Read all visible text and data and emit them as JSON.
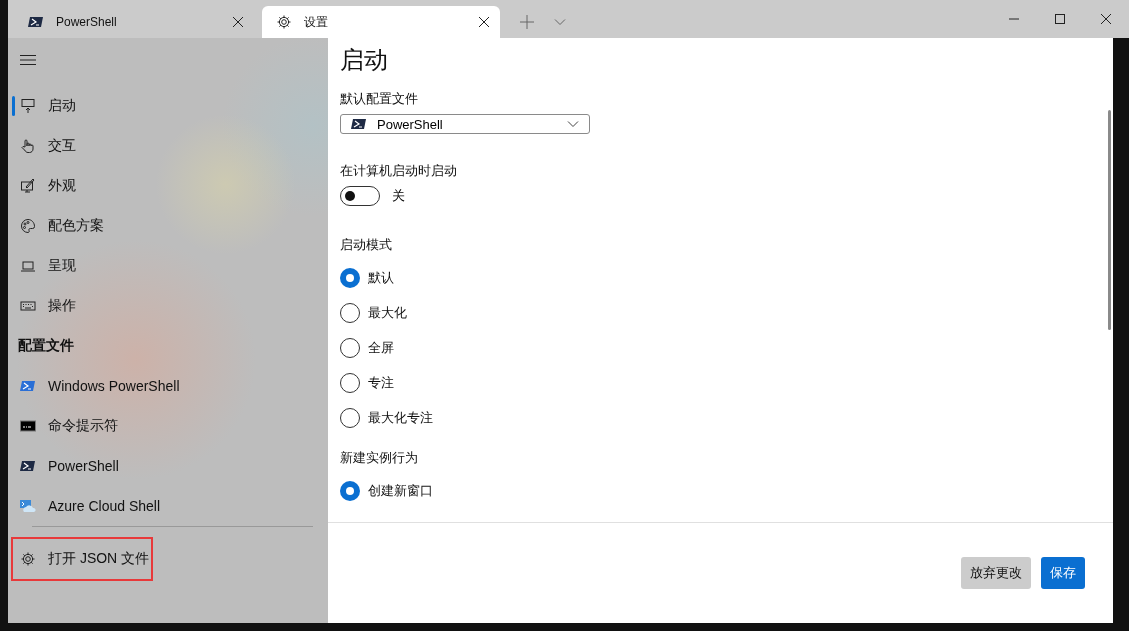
{
  "tabs": [
    {
      "label": "PowerShell",
      "selected": false
    },
    {
      "label": "设置",
      "selected": true
    }
  ],
  "sidebar": {
    "items": [
      {
        "label": "启动",
        "selected": true
      },
      {
        "label": "交互",
        "selected": false
      },
      {
        "label": "外观",
        "selected": false
      },
      {
        "label": "配色方案",
        "selected": false
      },
      {
        "label": "呈现",
        "selected": false
      },
      {
        "label": "操作",
        "selected": false
      }
    ],
    "profiles_heading": "配置文件",
    "profiles": [
      {
        "label": "Windows PowerShell",
        "selected": false
      },
      {
        "label": "命令提示符",
        "selected": false
      },
      {
        "label": "PowerShell",
        "selected": false
      },
      {
        "label": "Azure Cloud Shell",
        "selected": false
      }
    ],
    "open_json": {
      "label": "打开 JSON 文件",
      "highlighted": true
    }
  },
  "page": {
    "title": "启动",
    "default_profile": {
      "label": "默认配置文件",
      "value": "PowerShell"
    },
    "launch_on_startup": {
      "label": "在计算机启动时启动",
      "on": false,
      "state_text": "关"
    },
    "launch_mode": {
      "label": "启动模式",
      "options": [
        {
          "label": "默认",
          "selected": true
        },
        {
          "label": "最大化",
          "selected": false
        },
        {
          "label": "全屏",
          "selected": false
        },
        {
          "label": "专注",
          "selected": false
        },
        {
          "label": "最大化专注",
          "selected": false
        }
      ]
    },
    "new_instance": {
      "label": "新建实例行为",
      "options": [
        {
          "label": "创建新窗口",
          "selected": true
        }
      ]
    }
  },
  "buttons": [
    {
      "label": "放弃更改",
      "kind": "secondary"
    },
    {
      "label": "保存",
      "kind": "primary"
    }
  ]
}
